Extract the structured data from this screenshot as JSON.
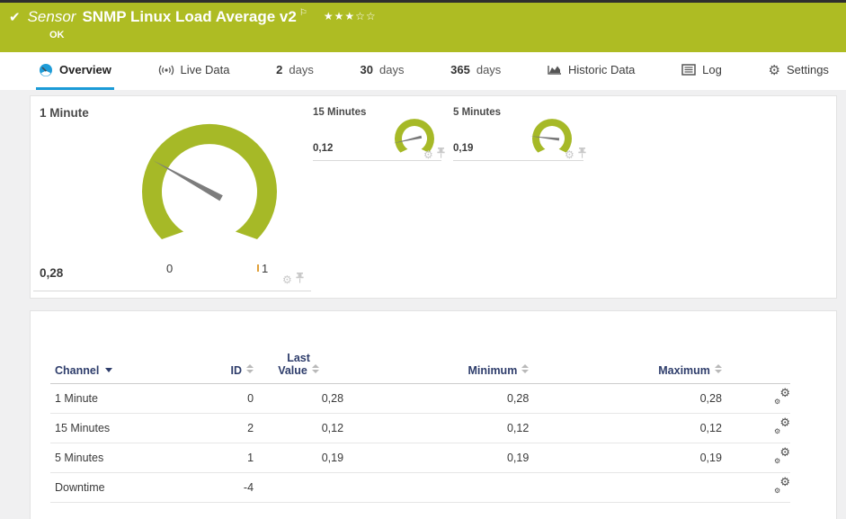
{
  "colors": {
    "brand_green": "#aebc23",
    "gauge_green": "#a6b927",
    "needle_grey": "#7d7d7d",
    "tab_active_blue": "#1b9bd7",
    "table_header_navy": "#2e3d6b"
  },
  "icons": {
    "check": "✔",
    "flag": "⚐",
    "stars_filled": "★★★",
    "stars_empty": "☆☆",
    "gear": "⚙"
  },
  "header": {
    "kind_label": "Sensor",
    "name": "SNMP Linux Load Average v2",
    "status": "OK",
    "rating_filled": 3,
    "rating_total": 5
  },
  "tabs": [
    {
      "label": "Overview",
      "icon": "gauge-icon",
      "active": true
    },
    {
      "label": "Live Data",
      "icon": "broadcast-icon",
      "active": false
    },
    {
      "prefix": "2",
      "label": "days",
      "active": false
    },
    {
      "prefix": "30",
      "label": "days",
      "active": false
    },
    {
      "prefix": "365",
      "label": "days",
      "active": false
    },
    {
      "label": "Historic Data",
      "icon": "area-chart-icon",
      "active": false
    },
    {
      "label": "Log",
      "icon": "log-icon",
      "active": false
    },
    {
      "label": "Settings",
      "icon": "gear-icon",
      "active": false
    }
  ],
  "gauges": [
    {
      "title": "1 Minute",
      "value": "0,28",
      "numeric_value": 0.28,
      "scale_min": "0",
      "scale_max": "1"
    },
    {
      "title": "15 Minutes",
      "value": "0,12",
      "numeric_value": 0.12
    },
    {
      "title": "5 Minutes",
      "value": "0,19",
      "numeric_value": 0.19
    }
  ],
  "table": {
    "headers": {
      "channel": "Channel",
      "id": "ID",
      "last_value_line1": "Last",
      "last_value_line2": "Value",
      "minimum": "Minimum",
      "maximum": "Maximum"
    },
    "rows": [
      {
        "channel": "1 Minute",
        "id": "0",
        "last_value": "0,28",
        "minimum": "0,28",
        "maximum": "0,28"
      },
      {
        "channel": "15 Minutes",
        "id": "2",
        "last_value": "0,12",
        "minimum": "0,12",
        "maximum": "0,12"
      },
      {
        "channel": "5 Minutes",
        "id": "1",
        "last_value": "0,19",
        "minimum": "0,19",
        "maximum": "0,19"
      },
      {
        "channel": "Downtime",
        "id": "-4",
        "last_value": "",
        "minimum": "",
        "maximum": ""
      }
    ]
  }
}
